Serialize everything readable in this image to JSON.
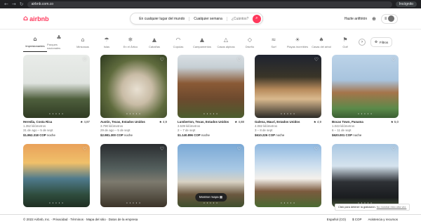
{
  "browser": {
    "url": "airbnb.com.co",
    "profile": "Incógnito"
  },
  "header": {
    "logo": "airbnb",
    "search": {
      "location": "En cualquier lugar del mundo",
      "week": "Cualquier semana",
      "guests": "¿Cuántos?"
    },
    "host_link": "Hazte anfitrión"
  },
  "categories": [
    {
      "label": "Impresionantes",
      "icon": "pool-icon",
      "glyph": "⌂"
    },
    {
      "label": "Parques nacionales",
      "icon": "tree-icon",
      "glyph": "♣"
    },
    {
      "label": "Minicasas",
      "icon": "tiny-home-icon",
      "glyph": "⌂"
    },
    {
      "label": "Islas",
      "icon": "island-icon",
      "glyph": "☂"
    },
    {
      "label": "En el Ártico",
      "icon": "snowflake-icon",
      "glyph": "❄"
    },
    {
      "label": "Cabañas",
      "icon": "cabin-icon",
      "glyph": "▲"
    },
    {
      "label": "Cúpulas",
      "icon": "dome-icon",
      "glyph": "◠"
    },
    {
      "label": "Campamentos",
      "icon": "tent-icon",
      "glyph": "▲"
    },
    {
      "label": "Casas alpinas",
      "icon": "a-frame-icon",
      "glyph": "△"
    },
    {
      "label": "Diseño",
      "icon": "design-icon",
      "glyph": "◇"
    },
    {
      "label": "Surf",
      "icon": "surf-icon",
      "glyph": "≈"
    },
    {
      "label": "Playas increíbles",
      "icon": "beach-icon",
      "glyph": "☀"
    },
    {
      "label": "Casas del árbol",
      "icon": "treehouse-icon",
      "glyph": "♠"
    },
    {
      "label": "Golf",
      "icon": "golf-icon",
      "glyph": "⚑"
    }
  ],
  "filters_label": "Filtros",
  "listings": [
    {
      "title": "Heredia, Costa Rica",
      "rating": "4,87",
      "distance": "1.352 kilómetros",
      "dates": "31 de ago – 5 de sept",
      "price": "$1.862.318 COP",
      "per": "noche",
      "bg": "linear-gradient(180deg,#e9ece9 0%,#dfe3df 45%,#4e5f3c 70%,#2f3a23 100%)"
    },
    {
      "title": "Austin, Texas, Estados Unidos",
      "rating": "4,9",
      "distance": "3.790 kilómetros",
      "dates": "29 de ago – 5 de sept",
      "price": "$2.981.300 COP",
      "per": "noche",
      "bg": "radial-gradient(circle at 55% 55%,#e8e0d2 0%,#c9bca6 30%,#5f6b3d 60%,#2e3a1f 100%)"
    },
    {
      "title": "Lumberton, Texas, Estados Unidos",
      "rating": "4,88",
      "distance": "3.539 kilómetros",
      "dates": "2 – 7 de sept",
      "price": "$1.140.896 COP",
      "per": "noche",
      "bg": "linear-gradient(180deg,#d9dfe4 0%,#c6cfd4 20%,#8a5a36 45%,#6d4a2e 70%,#4b5d2e 100%)"
    },
    {
      "title": "Galena, Maurí, Estados Unidos",
      "rating": "4,9",
      "distance": "4.082 kilómetros",
      "dates": "3 – 8 de sept",
      "price": "$610.226 COP",
      "per": "noche",
      "bg": "linear-gradient(180deg,#1e2330 0%,#3a3528 35%,#b88b5c 55%,#d9b98e 70%,#2b2a26 100%)"
    },
    {
      "title": "Bocas Town, Panama",
      "rating": "5,0",
      "distance": "1.043 kilómetros",
      "dates": "6 – 11 de sept",
      "price": "$620.001 COP",
      "per": "noche",
      "bg": "linear-gradient(180deg,#bcd3e8 0%,#a8c4de 40%,#a5744a 60%,#5b8a4a 85%,#3a5e32 100%)"
    },
    {
      "title": "",
      "rating": "",
      "distance": "",
      "dates": "",
      "price": "",
      "per": "",
      "bg": "linear-gradient(180deg,#e9a15a 0%,#f0c06a 30%,#4f7a8c 55%,#2f4d3e 80%,#1f2f22 100%)"
    },
    {
      "title": "",
      "rating": "",
      "distance": "",
      "dates": "",
      "price": "",
      "per": "",
      "bg": "linear-gradient(180deg,#2a2d30 0%,#55605e 40%,#7d7a6e 60%,#3b3328 100%)"
    },
    {
      "title": "",
      "rating": "",
      "distance": "",
      "dates": "",
      "price": "",
      "per": "",
      "bg": "linear-gradient(180deg,#7aa9d6 0%,#a8c8e4 40%,#d8d2c4 60%,#6b5840 80%,#3f4f2e 100%)"
    },
    {
      "title": "",
      "rating": "",
      "distance": "",
      "dates": "",
      "price": "",
      "per": "",
      "bg": "linear-gradient(180deg,#8fb8e0 0%,#cfe0ef 35%,#f4f1ec 55%,#7b5a3e 75%,#4a6a32 100%)"
    },
    {
      "title": "",
      "rating": "",
      "distance": "",
      "dates": "",
      "price": "",
      "per": "",
      "bg": "linear-gradient(180deg,#a9c7e2 0%,#d5e3ee 35%,#2e3136 60%,#1a1c1f 85%,#4b5a3c 100%)"
    }
  ],
  "map_button": "Mostrar mapa",
  "tooltip": {
    "text": "Click para detener la grabación.",
    "link": "No mostrar esto otra vez."
  },
  "footer": {
    "left": "© 2022 Airbnb, Inc. · Privacidad · Términos · Mapa del sitio · Datos de la empresa",
    "language": "Español (CO)",
    "currency": "$ COP",
    "support": "Asistencia y recursos"
  },
  "colors": {
    "brand": "#ff385c"
  }
}
